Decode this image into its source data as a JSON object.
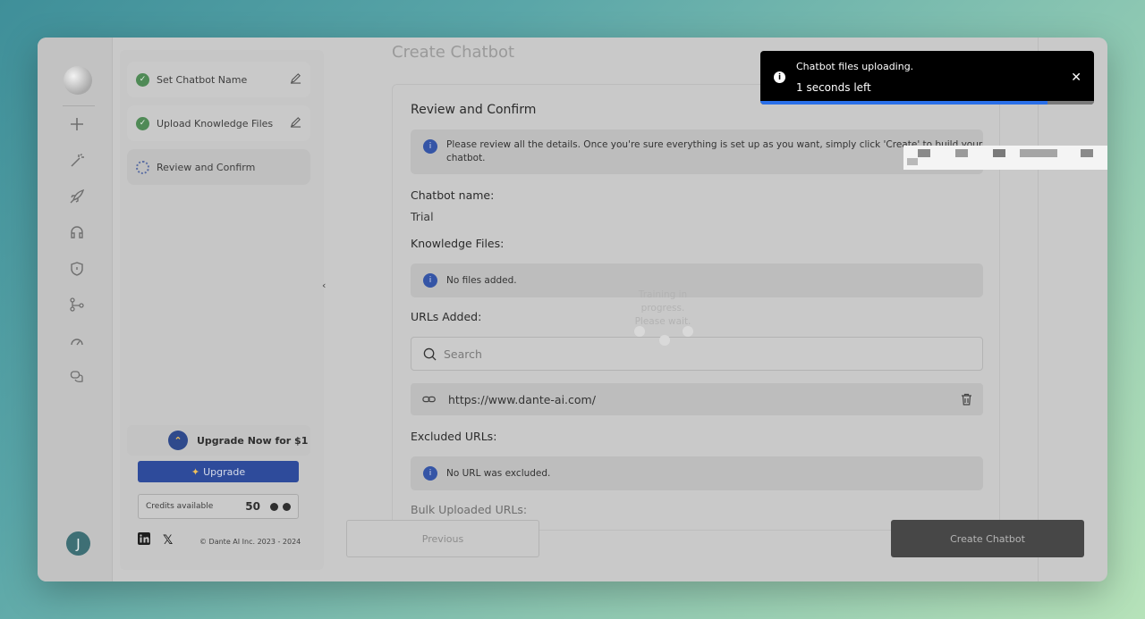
{
  "sidebar": {
    "steps": [
      {
        "label": "Set Chatbot Name",
        "status": "done"
      },
      {
        "label": "Upload Knowledge Files",
        "status": "done"
      },
      {
        "label": "Review and Confirm",
        "status": "in-progress"
      }
    ],
    "upgrade_now_label": "Upgrade Now for $1",
    "upgrade_button_label": "Upgrade",
    "credits_label": "Credits available",
    "credits_value": "50",
    "copyright": "© Dante AI Inc. 2023 - 2024",
    "avatar_initial": "J",
    "rail_icons": [
      "plus-icon",
      "magic-wand-icon",
      "rocket-icon",
      "headset-icon",
      "shield-icon",
      "branch-icon",
      "gauge-icon",
      "chat-bubbles-icon"
    ]
  },
  "main": {
    "page_title": "Create Chatbot",
    "card_title": "Review and Confirm",
    "intro_line1": "Please review all the details. Once you're sure everything is set up as you want, simply click 'Create' to build your",
    "intro_line2": "chatbot.",
    "chatbot_name_label": "Chatbot name:",
    "chatbot_name_value": "Trial",
    "knowledge_files_label": "Knowledge Files:",
    "knowledge_files_info": "No files added.",
    "urls_added_label": "URLs Added:",
    "search_placeholder": "Search",
    "urls": [
      "https://www.dante-ai.com/"
    ],
    "excluded_urls_label": "Excluded URLs:",
    "excluded_urls_info": "No URL was excluded.",
    "bulk_uploaded_label": "Bulk Uploaded URLs:",
    "training_line1": "Training in",
    "training_line2": "progress.",
    "training_line3": "Please wait.",
    "previous_label": "Previous",
    "create_label": "Create Chatbot"
  },
  "toast": {
    "title": "Chatbot files uploading.",
    "subtitle": "1 seconds left",
    "progress": 0.86
  },
  "colors": {
    "accent": "#2e4b9b",
    "success": "#4f8a56",
    "progress": "#2a6fe8"
  }
}
